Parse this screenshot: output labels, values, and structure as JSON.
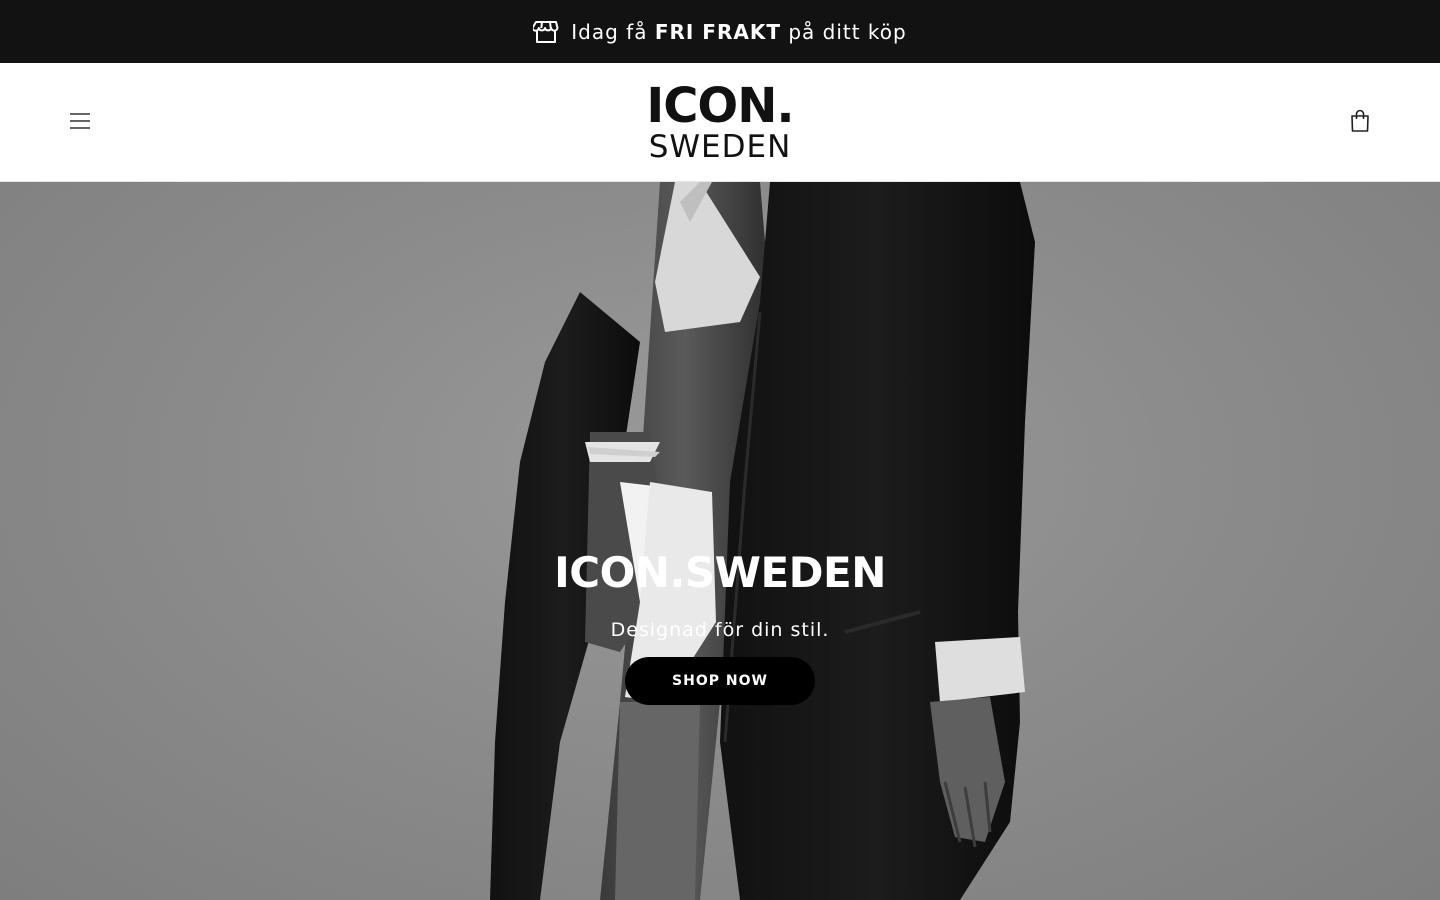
{
  "announcement": {
    "prefix": "Idag få",
    "highlight": "FRI FRAKT",
    "suffix": "på ditt köp",
    "icon": "store-icon"
  },
  "header": {
    "logo_top": "ICON.",
    "logo_bottom": "SWEDEN",
    "menu_icon": "hamburger-menu-icon",
    "cart_icon": "shopping-bag-icon"
  },
  "hero": {
    "title": "ICON.SWEDEN",
    "subtitle": "Designad för din stil.",
    "button_label": "SHOP NOW"
  },
  "colors": {
    "announcement_bg": "#121212",
    "header_bg": "#ffffff",
    "button_bg": "#000000",
    "text_light": "#ffffff"
  }
}
